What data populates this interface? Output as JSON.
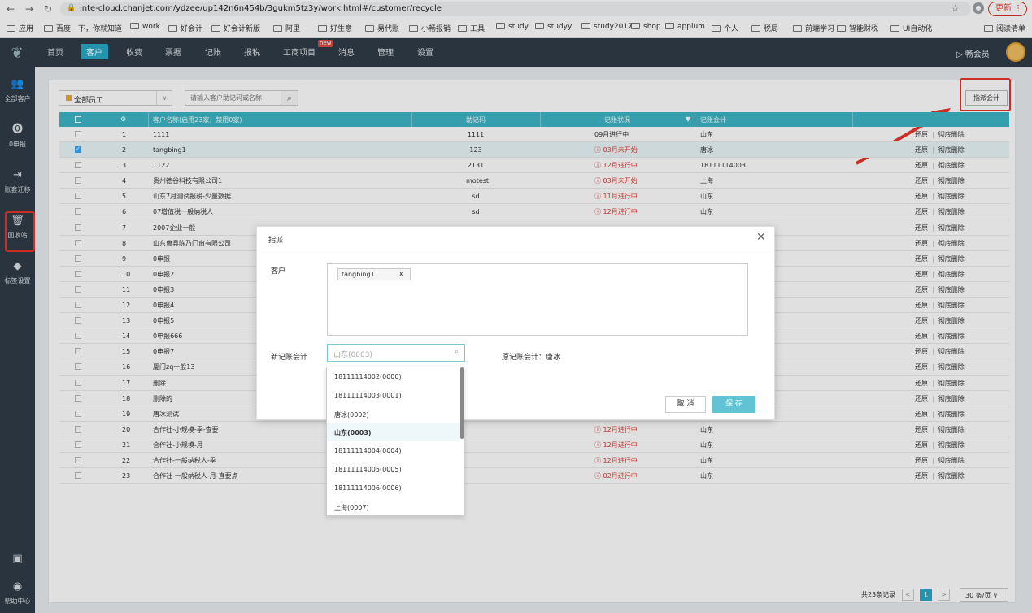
{
  "browser": {
    "url": "inte-cloud.chanjet.com/ydzee/up142n6n454b/3gukm5tz3y/work.html#/customer/recycle",
    "update_label": "更新",
    "bookmarks": [
      "应用",
      "百度一下，你就知道",
      "work",
      "好会计",
      "好会计新版",
      "阿里",
      "好生意",
      "易代账",
      "小畅报销",
      "工具",
      "study",
      "studyy",
      "study2017",
      "shop",
      "appium",
      "个人",
      "税局",
      "前端学习",
      "智能财税",
      "UI自动化",
      "阅读清单"
    ]
  },
  "nav": {
    "items": [
      "首页",
      "客户",
      "收费",
      "票据",
      "记账",
      "报税",
      "工商项目",
      "消息",
      "管理",
      "设置"
    ],
    "active": "客户",
    "new_badge": "new",
    "member": "畅会员"
  },
  "sidebar": {
    "items": [
      {
        "label": "全部客户",
        "icon": "users-icon"
      },
      {
        "label": "0申报",
        "icon": "zero-icon"
      },
      {
        "label": "账套迁移",
        "icon": "migrate-icon"
      },
      {
        "label": "回收站",
        "icon": "trash-icon"
      },
      {
        "label": "标签设置",
        "icon": "tag-icon"
      }
    ],
    "help": "帮助中心"
  },
  "toolbar": {
    "employee_filter": "全部员工",
    "search_placeholder": "请输入客户助记码或名称",
    "assign_button": "指派会计"
  },
  "table": {
    "headers": [
      "客户名称(启用23家，禁用0家)",
      "助记码",
      "记账状况",
      "记账会计"
    ],
    "restore": "还原",
    "delete": "彻底删除",
    "rows": [
      {
        "no": "1",
        "name": "1111",
        "code": "1111",
        "status": "09月进行中",
        "warn": false,
        "acc": "山东",
        "sel": false
      },
      {
        "no": "2",
        "name": "tangbing1",
        "code": "123",
        "status": "03月未开始",
        "warn": true,
        "acc": "唐冰",
        "sel": true
      },
      {
        "no": "3",
        "name": "1122",
        "code": "2131",
        "status": "12月进行中",
        "warn": true,
        "acc": "18111114003",
        "sel": false
      },
      {
        "no": "4",
        "name": "贵州德谷科技有限公司1",
        "code": "motest",
        "status": "03月未开始",
        "warn": true,
        "acc": "上海",
        "sel": false
      },
      {
        "no": "5",
        "name": "山东7月测试报税-少量数据",
        "code": "sd",
        "status": "11月进行中",
        "warn": true,
        "acc": "山东",
        "sel": false
      },
      {
        "no": "6",
        "name": "07增值税一般纳税人",
        "code": "sd",
        "status": "12月进行中",
        "warn": true,
        "acc": "山东",
        "sel": false
      },
      {
        "no": "7",
        "name": "2007企业一般",
        "code": "",
        "status": "",
        "warn": false,
        "acc": "",
        "sel": false
      },
      {
        "no": "8",
        "name": "山东曹县陈乃门窗有限公司",
        "code": "",
        "status": "",
        "warn": false,
        "acc": "",
        "sel": false
      },
      {
        "no": "9",
        "name": "0申报",
        "code": "",
        "status": "",
        "warn": false,
        "acc": "",
        "sel": false
      },
      {
        "no": "10",
        "name": "0申报2",
        "code": "",
        "status": "",
        "warn": false,
        "acc": "",
        "sel": false
      },
      {
        "no": "11",
        "name": "0申报3",
        "code": "",
        "status": "",
        "warn": false,
        "acc": "",
        "sel": false
      },
      {
        "no": "12",
        "name": "0申报4",
        "code": "",
        "status": "",
        "warn": false,
        "acc": "",
        "sel": false
      },
      {
        "no": "13",
        "name": "0申报5",
        "code": "",
        "status": "",
        "warn": false,
        "acc": "",
        "sel": false
      },
      {
        "no": "14",
        "name": "0申报666",
        "code": "",
        "status": "",
        "warn": false,
        "acc": "",
        "sel": false
      },
      {
        "no": "15",
        "name": "0申报7",
        "code": "",
        "status": "",
        "warn": false,
        "acc": "",
        "sel": false
      },
      {
        "no": "16",
        "name": "厦门zq一般13",
        "code": "",
        "status": "",
        "warn": false,
        "acc": "",
        "sel": false
      },
      {
        "no": "17",
        "name": "删除",
        "code": "",
        "status": "",
        "warn": false,
        "acc": "",
        "sel": false
      },
      {
        "no": "18",
        "name": "删除的",
        "code": "",
        "status": "",
        "warn": false,
        "acc": "",
        "sel": false
      },
      {
        "no": "19",
        "name": "唐冰测试",
        "code": "",
        "status": "",
        "warn": false,
        "acc": "",
        "sel": false
      },
      {
        "no": "20",
        "name": "合作社-小规模-季-查要",
        "code": "",
        "status": "12月进行中",
        "warn": true,
        "acc": "山东",
        "sel": false
      },
      {
        "no": "21",
        "name": "合作社-小规模-月",
        "code": "",
        "status": "12月进行中",
        "warn": true,
        "acc": "山东",
        "sel": false
      },
      {
        "no": "22",
        "name": "合作社-一般纳税人-季",
        "code": "",
        "status": "12月进行中",
        "warn": true,
        "acc": "山东",
        "sel": false
      },
      {
        "no": "23",
        "name": "合作社-一般纳税人-月-直要点",
        "code": "",
        "status": "02月进行中",
        "warn": true,
        "acc": "山东",
        "sel": false
      }
    ]
  },
  "pager": {
    "total": "共23条记录",
    "prev": "<",
    "page": "1",
    "next": ">",
    "per_page": "30 条/页"
  },
  "modal": {
    "title": "指派",
    "customer_label": "客户",
    "customer_tag": "tangbing1",
    "tag_remove": "X",
    "new_accountant_label": "新记账会计",
    "new_accountant_value": "山东(0003)",
    "original_label": "原记账会计：唐冰",
    "cancel": "取 消",
    "save": "保 存"
  },
  "dropdown": {
    "options": [
      "18111114002(0000)",
      "18111114003(0001)",
      "唐冰(0002)",
      "山东(0003)",
      "18111114004(0004)",
      "18111114005(0005)",
      "18111114006(0006)",
      "上海(0007)"
    ],
    "highlighted": "山东(0003)"
  }
}
